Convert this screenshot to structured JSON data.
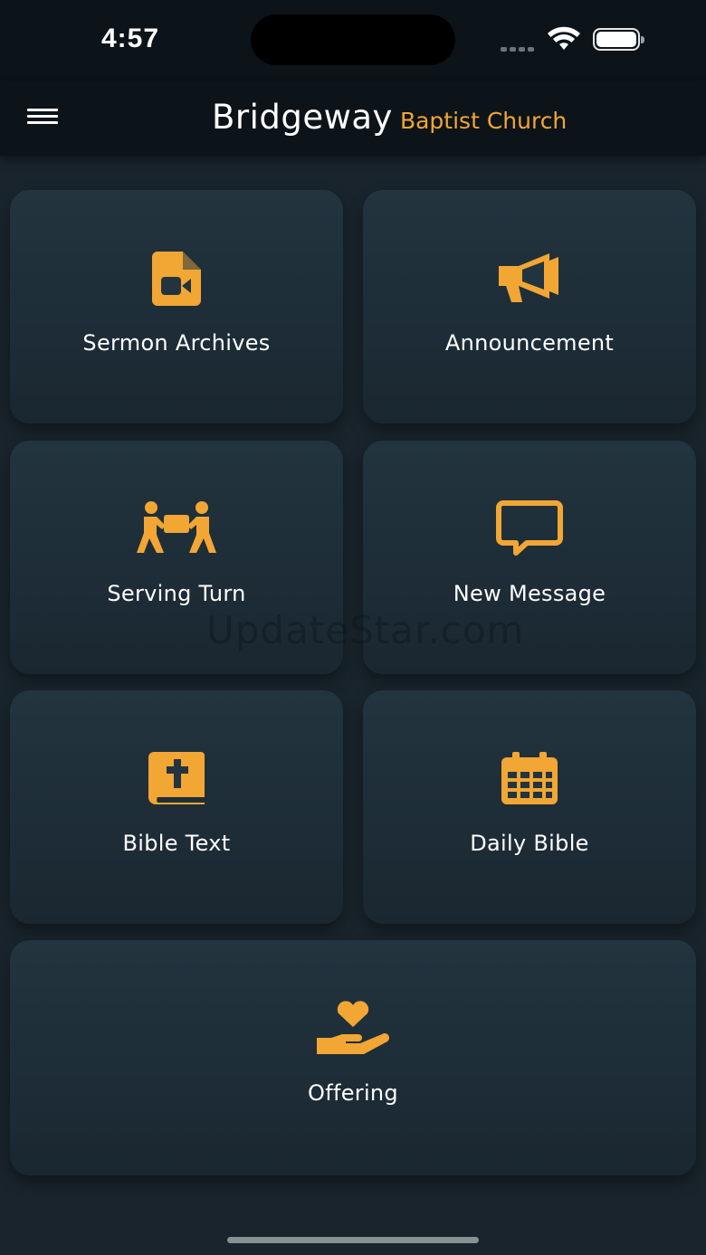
{
  "status_bar": {
    "time": "4:57"
  },
  "header": {
    "title_main": "Bridgeway",
    "title_sub": "Baptist Church"
  },
  "tiles": {
    "sermon": {
      "label": "Sermon Archives",
      "icon": "video-file-icon"
    },
    "announcement": {
      "label": "Announcement",
      "icon": "megaphone-icon"
    },
    "serving": {
      "label": "Serving Turn",
      "icon": "people-carry-icon"
    },
    "message": {
      "label": "New Message",
      "icon": "message-bubble-icon"
    },
    "bible": {
      "label": "Bible Text",
      "icon": "bible-icon"
    },
    "daily": {
      "label": "Daily Bible",
      "icon": "calendar-icon"
    },
    "offering": {
      "label": "Offering",
      "icon": "hand-heart-icon"
    }
  },
  "watermark": "UpdateStar.com",
  "colors": {
    "accent": "#f2a634",
    "background": "#19242c",
    "header": "#0d1419"
  }
}
